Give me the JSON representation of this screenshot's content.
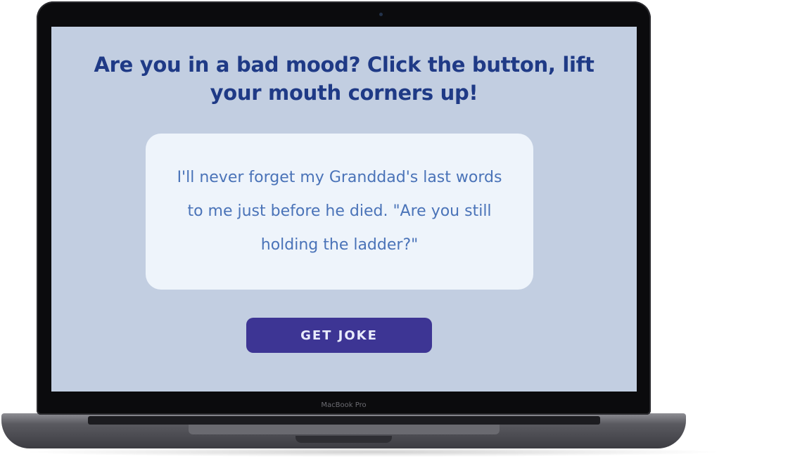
{
  "device": {
    "model_label": "MacBook Pro"
  },
  "app": {
    "headline": "Are you in a bad mood? Click the button, lift your mouth corners up!",
    "joke": {
      "text": "I'll never forget my Granddad's last words to me just before he died. \"Are you still holding the ladder?\""
    },
    "button": {
      "label": "GET JOKE"
    }
  },
  "colors": {
    "screen_background": "#c2cee1",
    "headline": "#1f3a86",
    "card_background": "#eef4fb",
    "joke_text": "#4a73b8",
    "button_background": "#3d3594",
    "button_text": "#e9ecfb"
  }
}
